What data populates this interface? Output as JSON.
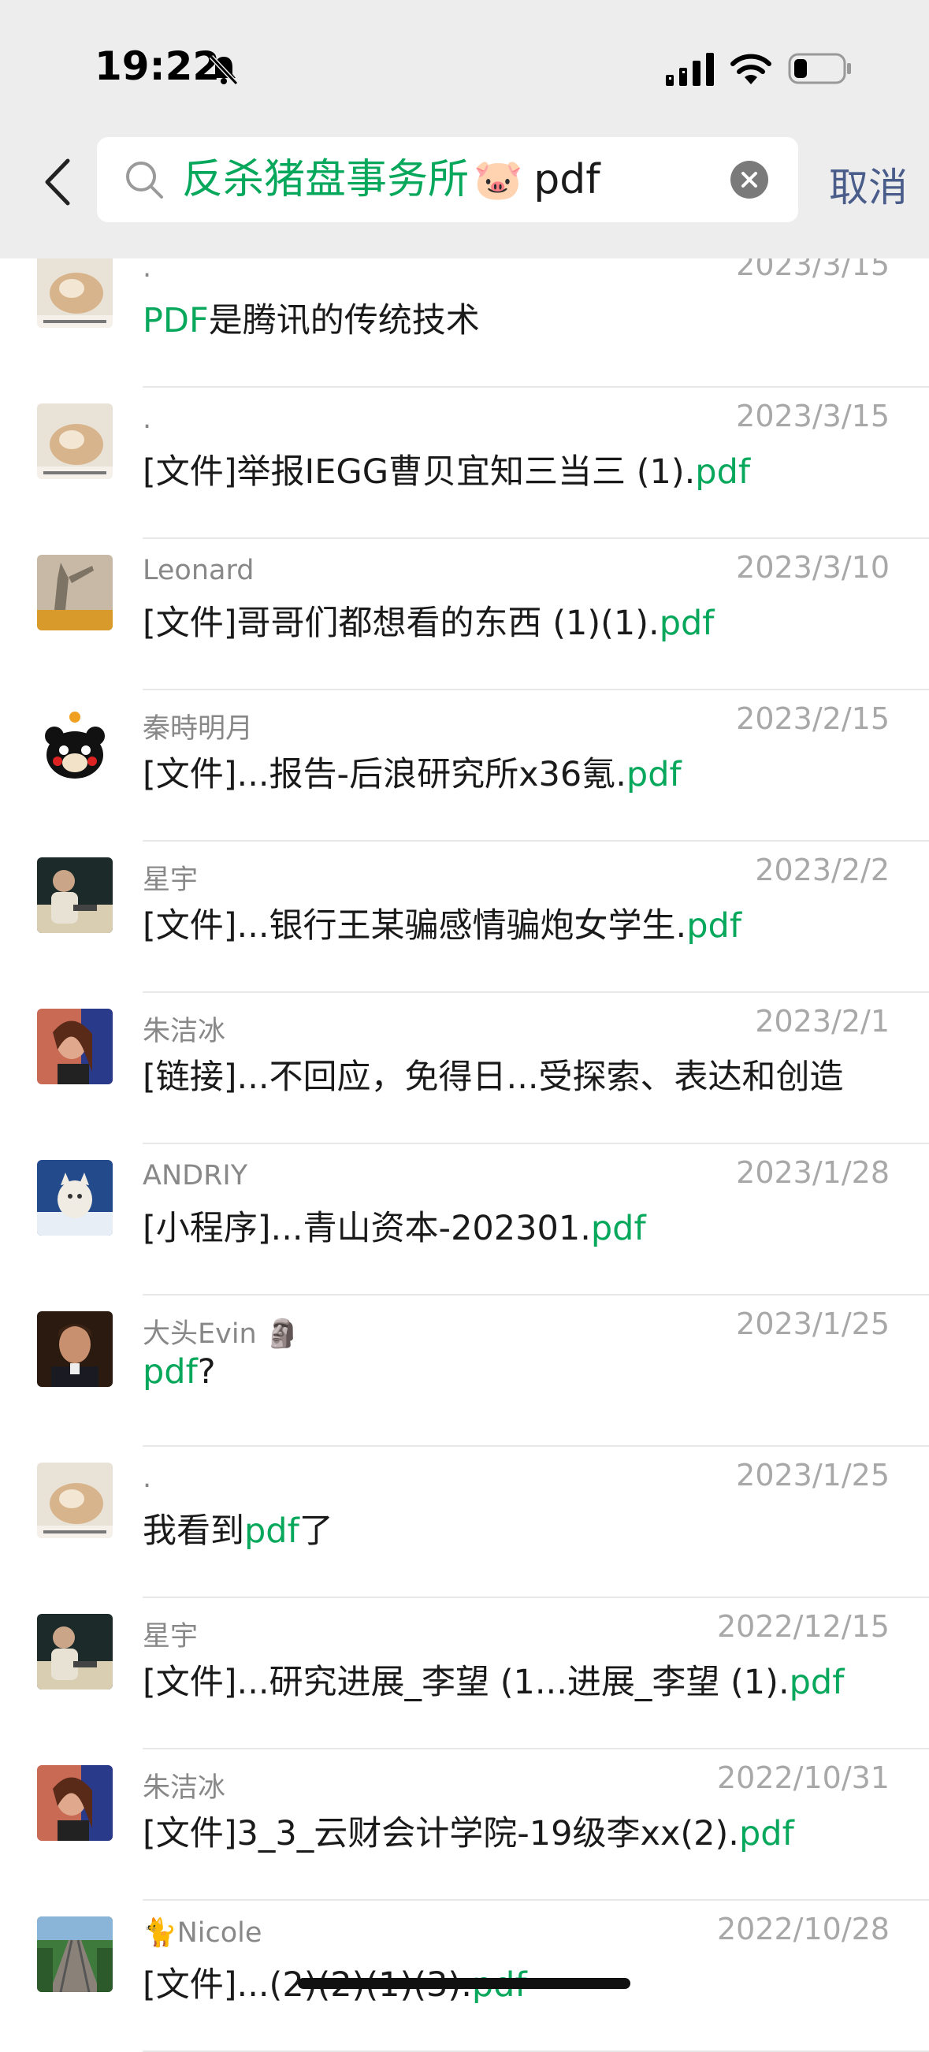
{
  "status_bar": {
    "time": "19:22"
  },
  "search": {
    "query_green": "反杀猪盘事务所",
    "query_emoji": "🐷",
    "query_black": "pdf",
    "cancel_label": "取消"
  },
  "colors": {
    "highlight": "#07a85c",
    "cancel": "#4a5d8a",
    "topbar": "#ededed"
  },
  "results": [
    {
      "name": ".",
      "date": "2023/3/15",
      "avatar": "dog-photo",
      "parts": [
        {
          "t": "PDF",
          "h": true
        },
        {
          "t": "是腾讯的传统技术",
          "h": false
        }
      ]
    },
    {
      "name": ".",
      "date": "2023/3/15",
      "avatar": "dog-photo",
      "parts": [
        {
          "t": "[文件]举报IEGG曹贝宜知三当三 (1).",
          "h": false
        },
        {
          "t": "pdf",
          "h": true
        }
      ]
    },
    {
      "name": "Leonard",
      "date": "2023/3/10",
      "avatar": "shadow-photo",
      "parts": [
        {
          "t": "[文件]哥哥们都想看的东西 (1)(1).",
          "h": false
        },
        {
          "t": "pdf",
          "h": true
        }
      ]
    },
    {
      "name": "秦時明月",
      "date": "2023/2/15",
      "avatar": "bear-cartoon",
      "parts": [
        {
          "t": "[文件]...报告-后浪研究所x36氪.",
          "h": false
        },
        {
          "t": "pdf",
          "h": true
        }
      ]
    },
    {
      "name": "星宇",
      "date": "2023/2/2",
      "avatar": "person-photo",
      "parts": [
        {
          "t": "[文件]...银行王某骗感情骗炮女学生.",
          "h": false
        },
        {
          "t": "pdf",
          "h": true
        }
      ]
    },
    {
      "name": "朱洁冰",
      "date": "2023/2/1",
      "avatar": "girl-photo",
      "parts": [
        {
          "t": "[链接]...不回应，免得日...受探索、表达和创造",
          "h": false
        }
      ]
    },
    {
      "name": "ANDRIY",
      "date": "2023/1/28",
      "avatar": "cat-photo",
      "parts": [
        {
          "t": "[小程序]...青山资本-202301.",
          "h": false
        },
        {
          "t": "pdf",
          "h": true
        }
      ]
    },
    {
      "name": "大头Evin 🗿",
      "date": "2023/1/25",
      "avatar": "man-photo",
      "parts": [
        {
          "t": "pdf",
          "h": true
        },
        {
          "t": "?",
          "h": false
        }
      ]
    },
    {
      "name": ".",
      "date": "2023/1/25",
      "avatar": "dog-photo",
      "parts": [
        {
          "t": "我看到",
          "h": false
        },
        {
          "t": "pdf",
          "h": true
        },
        {
          "t": "了",
          "h": false
        }
      ]
    },
    {
      "name": "星宇",
      "date": "2022/12/15",
      "avatar": "person-photo",
      "parts": [
        {
          "t": "[文件]...研究进展_李望 (1...进展_李望 (1).",
          "h": false
        },
        {
          "t": "pdf",
          "h": true
        }
      ]
    },
    {
      "name": "朱洁冰",
      "date": "2022/10/31",
      "avatar": "girl-photo",
      "parts": [
        {
          "t": "[文件]3_3_云财会计学院-19级李xx(2).",
          "h": false
        },
        {
          "t": "pdf",
          "h": true
        }
      ]
    },
    {
      "name": "🐈Nicole",
      "date": "2022/10/28",
      "avatar": "railway-photo",
      "parts": [
        {
          "t": "[文件]...(2)(2)(1)(3).",
          "h": false
        },
        {
          "t": "pdf",
          "h": true
        }
      ]
    }
  ]
}
